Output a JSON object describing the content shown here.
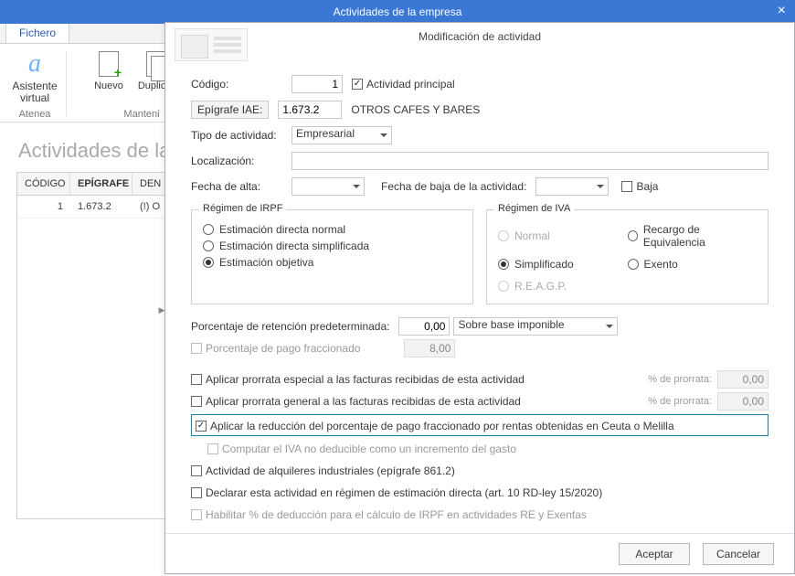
{
  "mainWindow": {
    "title": "Actividades de la empresa"
  },
  "tabs": {
    "fichero": "Fichero"
  },
  "ribbon": {
    "asistente_line1": "Asistente",
    "asistente_line2": "virtual",
    "group_atenea": "Atenea",
    "nuevo": "Nuevo",
    "duplicar": "Duplicar",
    "m_cut": "M",
    "group_mant": "Manteni"
  },
  "heading": "Actividades de la",
  "grid": {
    "h_codigo": "CÓDIGO",
    "h_epigrafe": "EPÍGRAFE",
    "h_den": "DEN",
    "r0": {
      "codigo": "1",
      "epigrafe": "1.673.2",
      "den": "(!) O"
    }
  },
  "dialog": {
    "title": "Modificación de actividad",
    "labels": {
      "codigo": "Código:",
      "epigrafe": "Epígrafe IAE:",
      "tipo": "Tipo de actividad:",
      "localizacion": "Localización:",
      "fecha_alta": "Fecha de alta:",
      "fecha_baja": "Fecha de baja de la actividad:",
      "actividad_principal": "Actividad principal",
      "baja": "Baja",
      "regimen_irpf": "Régimen de IRPF",
      "regimen_iva": "Régimen de IVA",
      "porc_ret": "Porcentaje de retención predeterminada:",
      "base_sel": "Sobre base imponible",
      "porc_pago_frac": "Porcentaje de pago fraccionado",
      "prorrata_esp": "Aplicar prorrata especial a las facturas recibidas de esta actividad",
      "prorrata_gen": "Aplicar prorrata general a las facturas recibidas de esta actividad",
      "pct_prorrata": "% de prorrata:",
      "ceuta": "Aplicar la reducción del porcentaje de pago fraccionado por rentas obtenidas en Ceuta o Melilla",
      "iva_no_deducible": "Computar el IVA no deducible como un incremento del gasto",
      "alquileres": "Actividad de alquileres industriales (epígrafe 861.2)",
      "declarar_ed": "Declarar esta actividad en régimen de estimación directa (art. 10 RD-ley 15/2020)",
      "habilitar_deduc": "Habilitar % de deducción para el cálculo de IRPF en actividades RE y Exentas"
    },
    "values": {
      "codigo": "1",
      "epigrafe": "1.673.2",
      "epigrafe_desc": "OTROS CAFES Y BARES",
      "tipo": "Empresarial",
      "localizacion": "",
      "fecha_alta": "",
      "fecha_baja": "",
      "porc_ret": "0,00",
      "porc_pago_frac": "8,00",
      "pct_prorrata_esp": "0,00",
      "pct_prorrata_gen": "0,00"
    },
    "irpf": {
      "edn": "Estimación directa normal",
      "eds": "Estimación directa simplificada",
      "eo": "Estimación objetiva"
    },
    "iva": {
      "normal": "Normal",
      "simplificado": "Simplificado",
      "reagp": "R.E.A.G.P.",
      "recargo": "Recargo de Equivalencia",
      "exento": "Exento"
    },
    "buttons": {
      "aceptar": "Aceptar",
      "cancelar": "Cancelar"
    }
  }
}
